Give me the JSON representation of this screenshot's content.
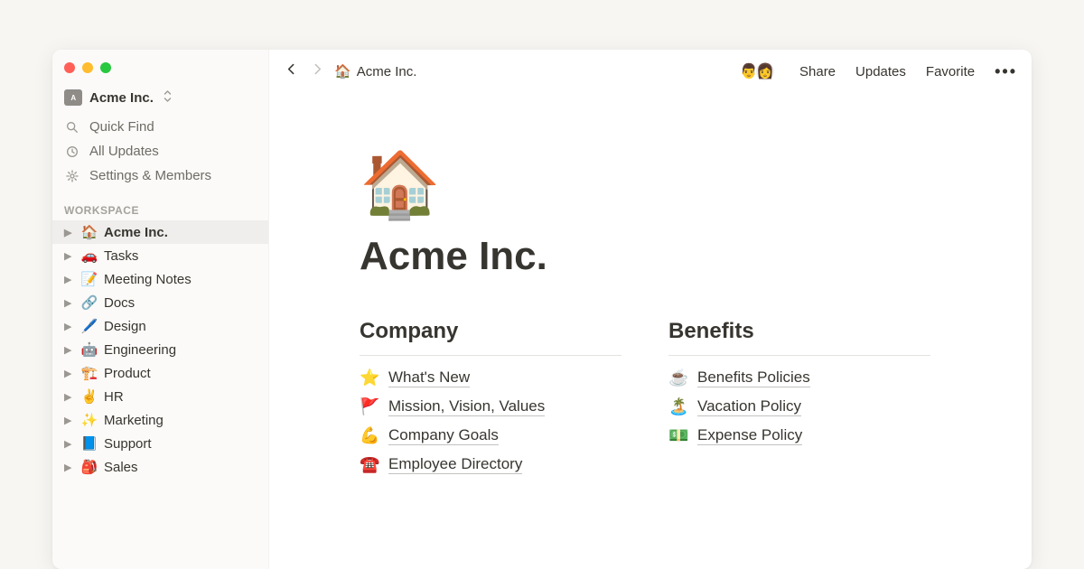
{
  "workspace": {
    "name": "Acme Inc."
  },
  "sidebar": {
    "quick_find": "Quick Find",
    "all_updates": "All Updates",
    "settings": "Settings & Members",
    "section_label": "WORKSPACE",
    "items": [
      {
        "emoji": "🏠",
        "label": "Acme Inc.",
        "active": true
      },
      {
        "emoji": "🚗",
        "label": "Tasks"
      },
      {
        "emoji": "📝",
        "label": "Meeting Notes"
      },
      {
        "emoji": "🔗",
        "label": "Docs"
      },
      {
        "emoji": "🖊️",
        "label": "Design"
      },
      {
        "emoji": "🤖",
        "label": "Engineering"
      },
      {
        "emoji": "🏗️",
        "label": "Product"
      },
      {
        "emoji": "✌️",
        "label": "HR"
      },
      {
        "emoji": "✨",
        "label": "Marketing"
      },
      {
        "emoji": "📘",
        "label": "Support"
      },
      {
        "emoji": "🎒",
        "label": "Sales"
      }
    ]
  },
  "topbar": {
    "breadcrumb_icon": "🏠",
    "breadcrumb_label": "Acme Inc.",
    "share": "Share",
    "updates": "Updates",
    "favorite": "Favorite"
  },
  "page": {
    "icon": "🏠",
    "title": "Acme Inc.",
    "columns": [
      {
        "heading": "Company",
        "links": [
          {
            "emoji": "⭐",
            "label": "What's New"
          },
          {
            "emoji": "🚩",
            "label": "Mission, Vision, Values"
          },
          {
            "emoji": "💪",
            "label": "Company Goals"
          },
          {
            "emoji": "☎️",
            "label": "Employee Directory"
          }
        ]
      },
      {
        "heading": "Benefits",
        "links": [
          {
            "emoji": "☕",
            "label": "Benefits Policies"
          },
          {
            "emoji": "🏝️",
            "label": "Vacation Policy"
          },
          {
            "emoji": "💵",
            "label": "Expense Policy"
          }
        ]
      }
    ]
  }
}
